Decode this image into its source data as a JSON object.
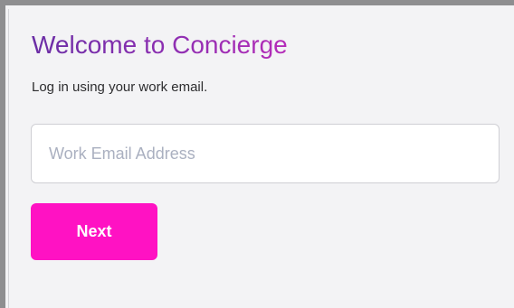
{
  "login": {
    "title": "Welcome to Concierge",
    "subtitle": "Log in using your work email.",
    "email": {
      "value": "",
      "placeholder": "Work Email Address"
    },
    "next_label": "Next"
  },
  "colors": {
    "title_gradient_start": "#6a2da5",
    "title_gradient_end": "#b52cb8",
    "button_background": "#ff12c3",
    "button_text": "#ffffff",
    "page_background": "#f3f3f5",
    "frame_border": "#8e8e90"
  }
}
